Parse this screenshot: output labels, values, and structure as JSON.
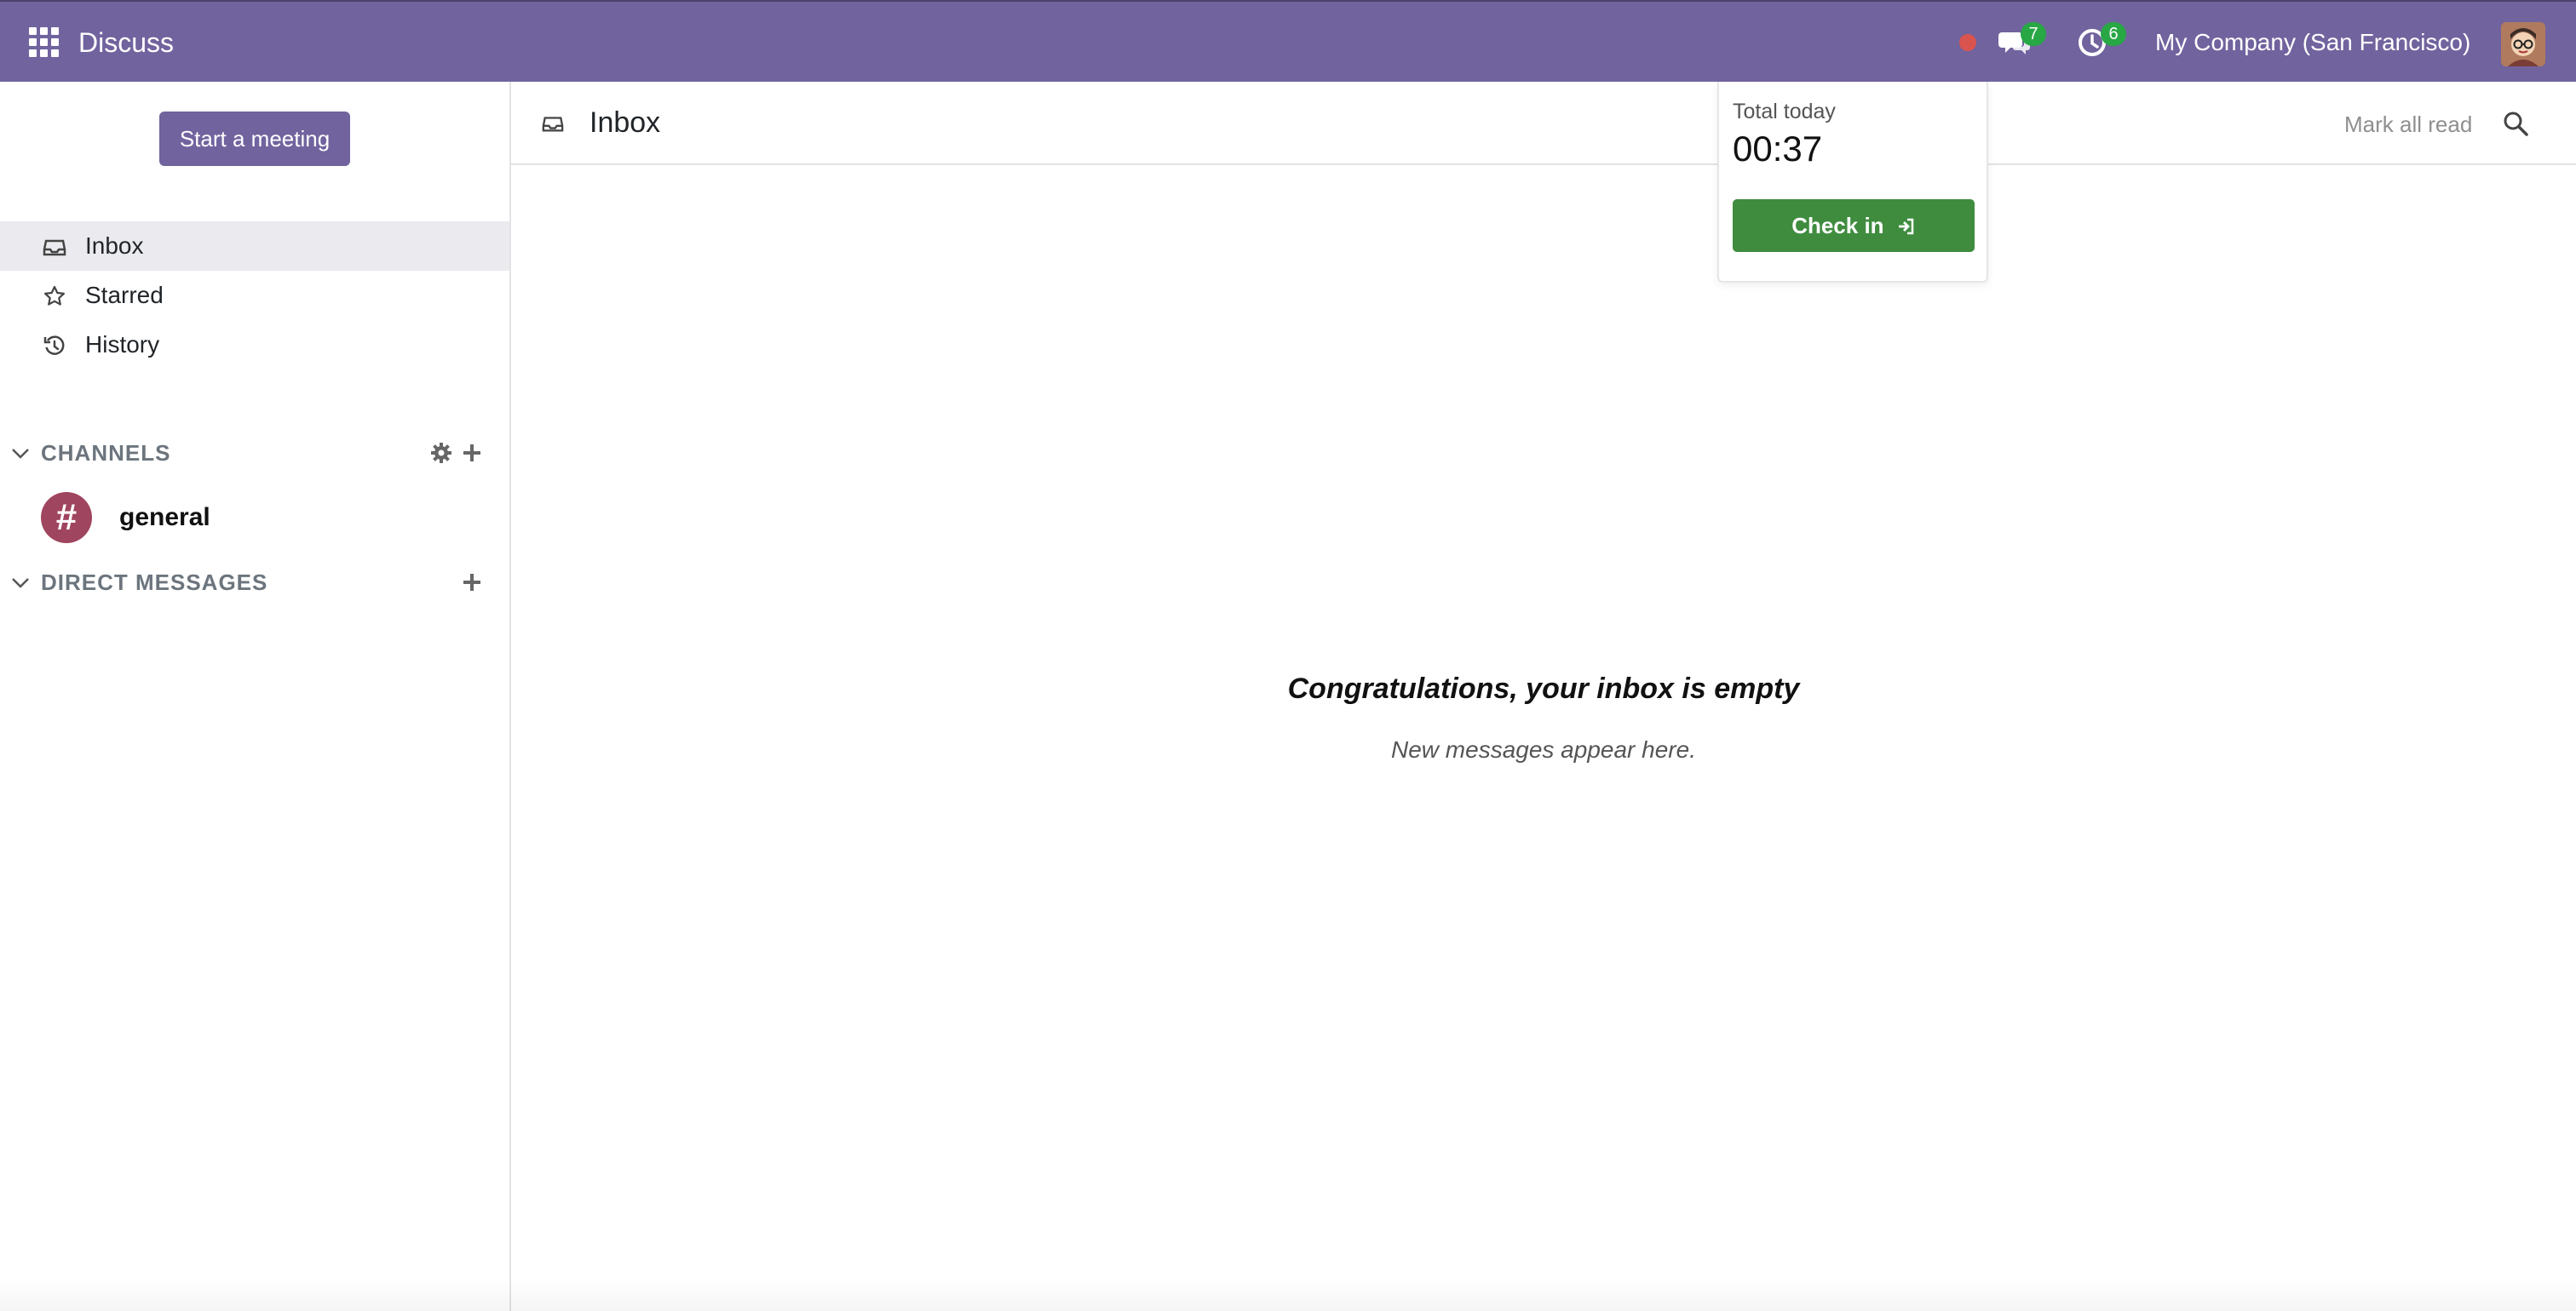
{
  "navbar": {
    "app_title": "Discuss",
    "chat_badge": "7",
    "activity_badge": "6",
    "company": "My Company (San Francisco)",
    "bg_color": "#71639e"
  },
  "sidebar": {
    "start_meeting": "Start a meeting",
    "items": [
      {
        "label": "Inbox",
        "icon": "inbox-icon",
        "active": true
      },
      {
        "label": "Starred",
        "icon": "star-icon"
      },
      {
        "label": "History",
        "icon": "history-icon"
      }
    ],
    "channels_title": "CHANNELS",
    "channels": [
      {
        "name": "general",
        "icon": "hash-icon",
        "color": "#a0455f"
      }
    ],
    "dm_title": "DIRECT MESSAGES"
  },
  "main": {
    "title": "Inbox",
    "mark_all_read": "Mark all read",
    "empty_title": "Congratulations, your inbox is empty",
    "empty_sub": "New messages appear here."
  },
  "attendance": {
    "label": "Total today",
    "time": "00:37",
    "checkin": "Check in",
    "checkin_color": "#3f8c3f"
  }
}
